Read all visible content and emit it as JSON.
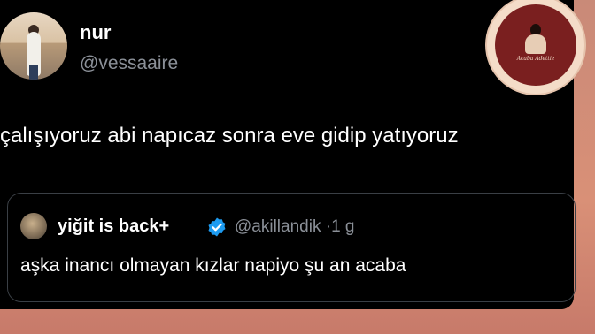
{
  "author": {
    "name": "nur",
    "handle": "@vessaaire"
  },
  "tweet": {
    "text": "çalışıyoruz abi napıcaz sonra eve gidip yatıyoruz"
  },
  "quoted": {
    "name": "yiğit is back+",
    "handle": "@akillandik",
    "separator": "·",
    "time": "1 g",
    "text": "aşka inancı olmayan kızlar napiyo şu an acaba",
    "verified_icon": "verified-badge-icon",
    "verified_color": "#1d9bf0"
  },
  "watermark": {
    "text": "Acaba Adettie"
  },
  "colors": {
    "background": "#000000",
    "muted": "#8b9098",
    "text": "#ffffff",
    "frame": "#d99077"
  }
}
